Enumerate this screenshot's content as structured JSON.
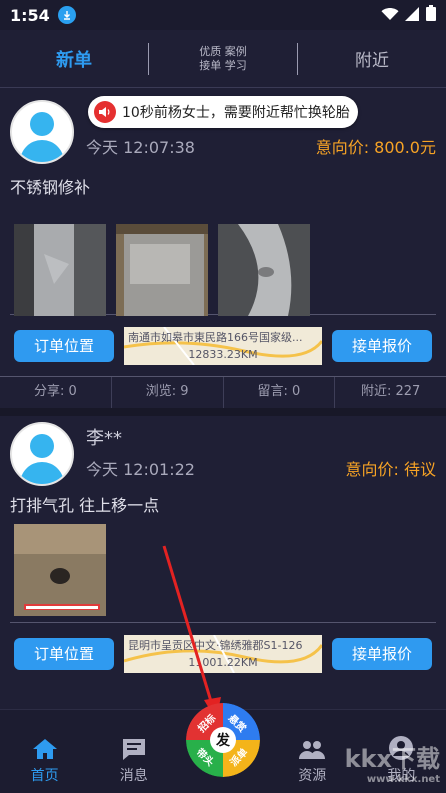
{
  "status_bar": {
    "time": "1:54"
  },
  "tabs": {
    "new": "新单",
    "middle_line1": "优质 案例",
    "middle_line2": "接单 学习",
    "nearby": "附近"
  },
  "toast": "10秒前杨女士，需要附近帮忙换轮胎",
  "orders": [
    {
      "user": "",
      "time": "今天 12:07:38",
      "price": "意向价: 800.0元",
      "description": "不锈钢修补",
      "map_address": "南通市如皋市東民路166号国家级...",
      "map_distance": "12833.23KM",
      "stats": [
        "分享: 0",
        "浏览: 9",
        "留言: 0",
        "附近: 227"
      ]
    },
    {
      "user": "李**",
      "time": "今天 12:01:22",
      "price": "意向价: 待议",
      "description": "打排气孔 往上移一点",
      "map_address": "昆明市呈贡区中文·锦绣雅郡S1-126",
      "map_distance": "11001.22KM"
    }
  ],
  "buttons": {
    "location": "订单位置",
    "quote": "接单报价"
  },
  "bottom_nav": {
    "home": "首页",
    "messages": "消息",
    "resources": "资源",
    "mine": "我的"
  },
  "fab": {
    "center": "发",
    "top_left": "招标",
    "top_right": "悬赏",
    "bottom_left": "带头",
    "bottom_right": "派单"
  },
  "watermark": {
    "main": "kkx下载",
    "sub": "www.kkx.net"
  },
  "colors": {
    "accent": "#2e9bf0",
    "price": "#f7a325",
    "background": "#1f1f35"
  }
}
